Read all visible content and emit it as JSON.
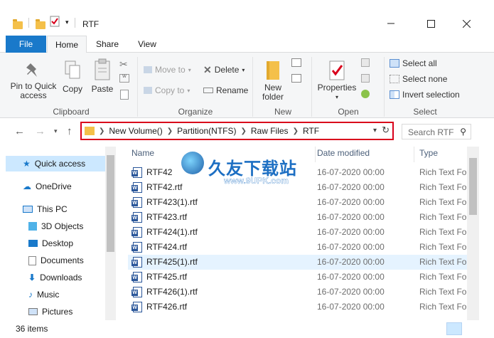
{
  "window": {
    "title": "RTF",
    "minimize_icon": "minimize-icon",
    "maximize_icon": "maximize-icon",
    "close_icon": "close-icon"
  },
  "ribbon_tabs": {
    "file": "File",
    "home": "Home",
    "share": "Share",
    "view": "View"
  },
  "ribbon": {
    "clipboard": {
      "label": "Clipboard",
      "pin": "Pin to Quick access",
      "copy": "Copy",
      "paste": "Paste"
    },
    "organize": {
      "label": "Organize",
      "move_to": "Move to",
      "copy_to": "Copy to",
      "delete": "Delete",
      "rename": "Rename"
    },
    "new": {
      "label": "New",
      "new_folder": "New folder"
    },
    "open": {
      "label": "Open",
      "properties": "Properties"
    },
    "select": {
      "label": "Select",
      "select_all": "Select all",
      "select_none": "Select none",
      "invert_selection": "Invert selection"
    }
  },
  "address": {
    "crumbs": [
      "New Volume()",
      "Partition(NTFS)",
      "Raw Files",
      "RTF"
    ],
    "search_placeholder": "Search RTF"
  },
  "navpane": {
    "items": [
      {
        "label": "Quick access",
        "icon": "star-icon",
        "selected": true
      },
      {
        "label": "OneDrive",
        "icon": "cloud-icon"
      },
      {
        "label": "This PC",
        "icon": "computer-icon"
      },
      {
        "label": "3D Objects",
        "icon": "cube-icon"
      },
      {
        "label": "Desktop",
        "icon": "desktop-icon"
      },
      {
        "label": "Documents",
        "icon": "documents-icon"
      },
      {
        "label": "Downloads",
        "icon": "download-arrow-icon"
      },
      {
        "label": "Music",
        "icon": "music-note-icon"
      },
      {
        "label": "Pictures",
        "icon": "pictures-icon"
      }
    ]
  },
  "filelist": {
    "columns": {
      "name": "Name",
      "date": "Date modified",
      "type": "Type"
    },
    "rows": [
      {
        "name": "RTF42",
        "date": "16-07-2020 00:00",
        "type": "Rich Text For"
      },
      {
        "name": "RTF42.rtf",
        "date": "16-07-2020 00:00",
        "type": "Rich Text For"
      },
      {
        "name": "RTF423(1).rtf",
        "date": "16-07-2020 00:00",
        "type": "Rich Text For"
      },
      {
        "name": "RTF423.rtf",
        "date": "16-07-2020 00:00",
        "type": "Rich Text For"
      },
      {
        "name": "RTF424(1).rtf",
        "date": "16-07-2020 00:00",
        "type": "Rich Text For"
      },
      {
        "name": "RTF424.rtf",
        "date": "16-07-2020 00:00",
        "type": "Rich Text For"
      },
      {
        "name": "RTF425(1).rtf",
        "date": "16-07-2020 00:00",
        "type": "Rich Text For",
        "selected": true
      },
      {
        "name": "RTF425.rtf",
        "date": "16-07-2020 00:00",
        "type": "Rich Text For"
      },
      {
        "name": "RTF426(1).rtf",
        "date": "16-07-2020 00:00",
        "type": "Rich Text For"
      },
      {
        "name": "RTF426.rtf",
        "date": "16-07-2020 00:00",
        "type": "Rich Text For"
      }
    ]
  },
  "status": {
    "item_count": "36 items"
  },
  "watermark": {
    "cn": "久友下载站",
    "url": "www.9UPK.com"
  },
  "colors": {
    "accent": "#1979ca",
    "highlight": "#d9001b",
    "selection": "#cce8ff"
  }
}
